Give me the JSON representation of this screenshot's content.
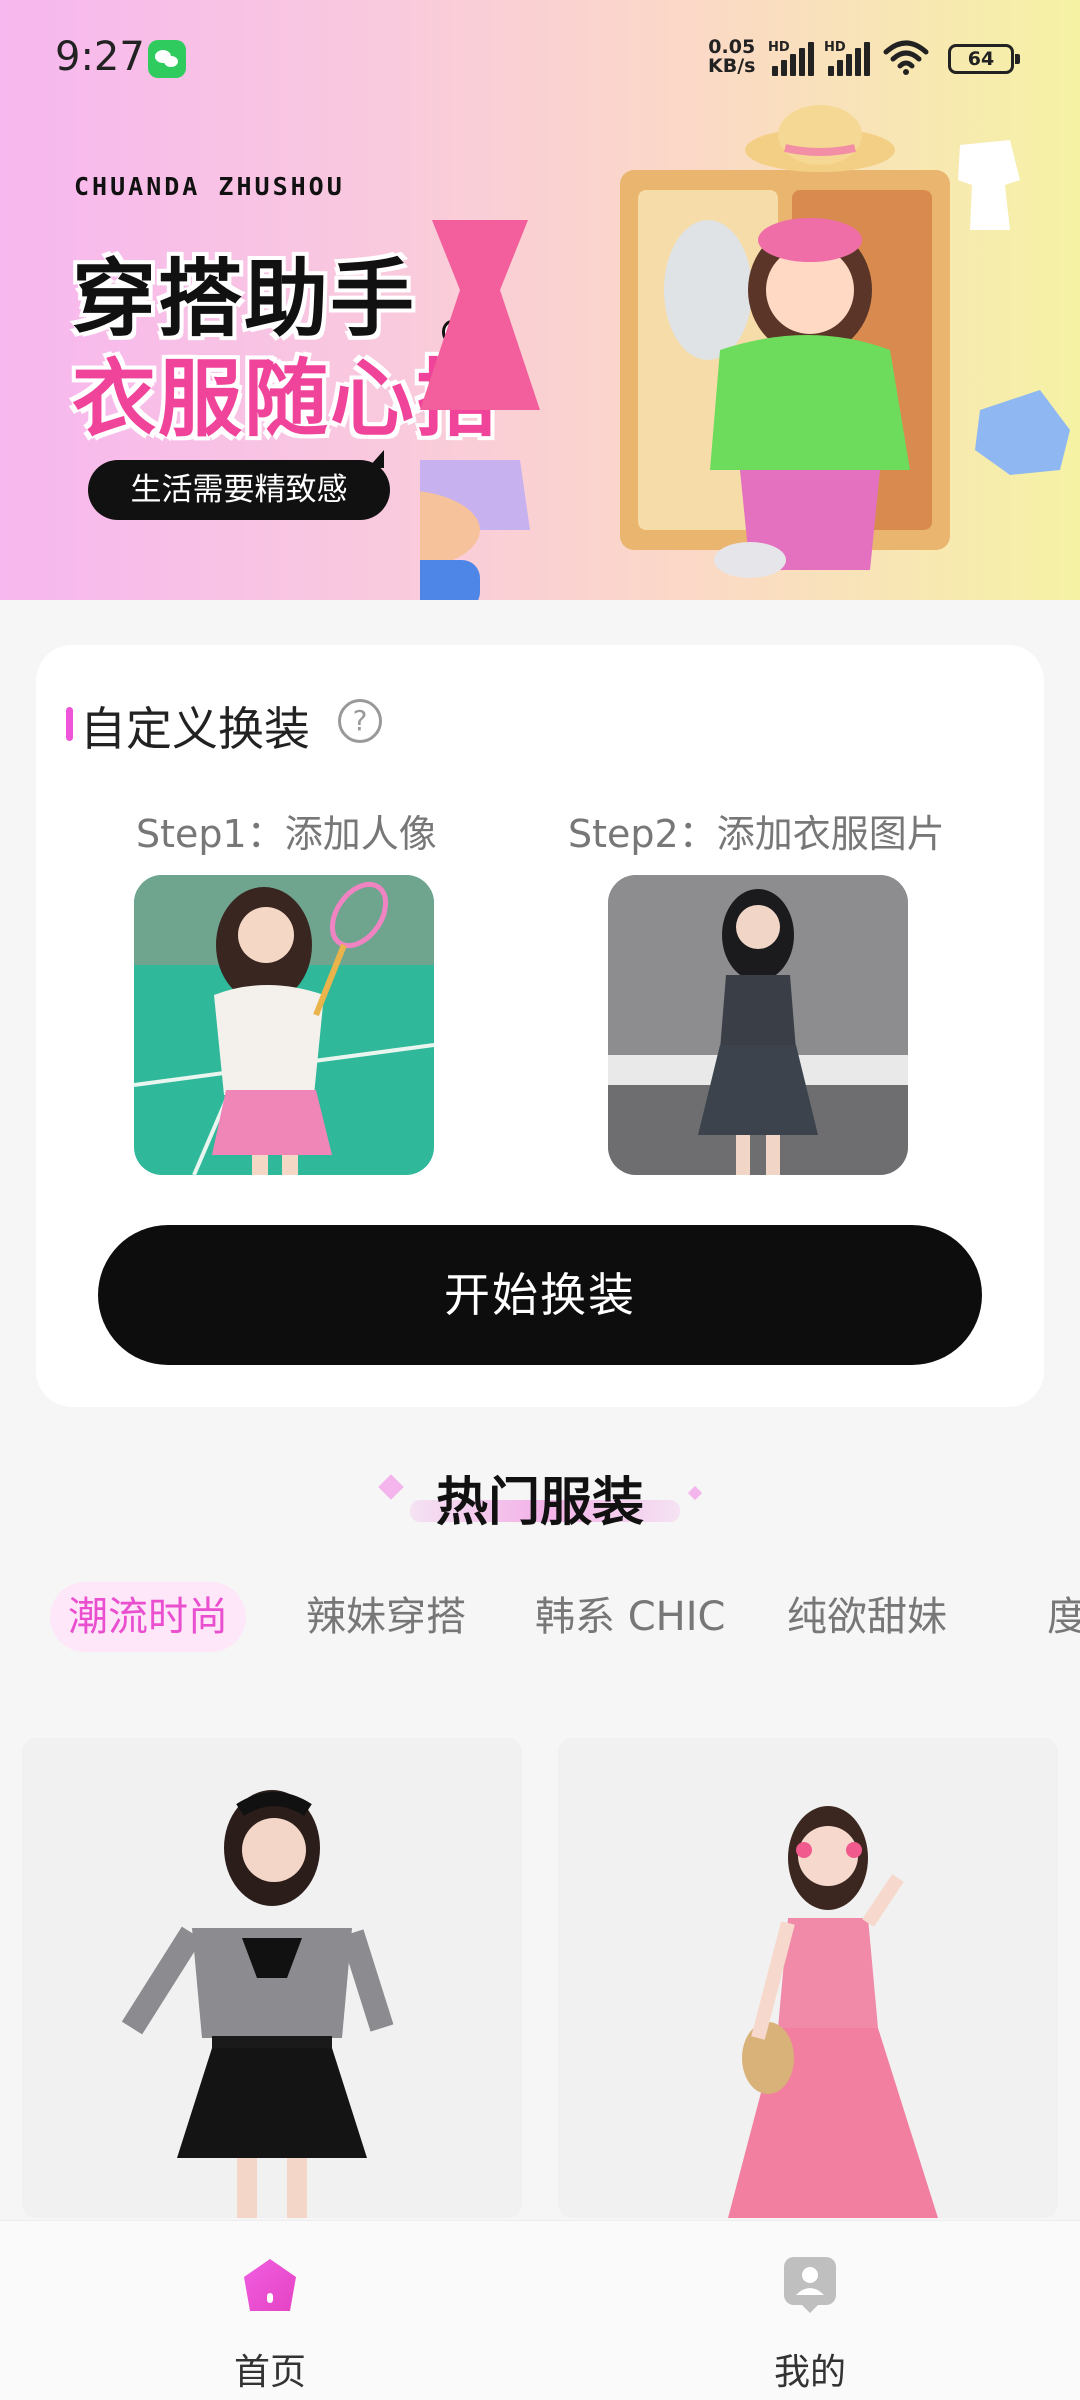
{
  "status_bar": {
    "time": "9:27",
    "net_speed_value": "0.05",
    "net_speed_unit": "KB/s",
    "signal_badge": "HD",
    "battery": "64"
  },
  "banner": {
    "brand_en": "CHUANDA ZHUSHOU",
    "title": "穿搭助手",
    "subtitle": "衣服随心搭",
    "slogan": "生活需要精致感",
    "accent_color": "#f0439a"
  },
  "custom": {
    "title": "自定义换装",
    "help": "?",
    "step1_label": "Step1：添加人像",
    "step2_label": "Step2：添加衣服图片",
    "start_button": "开始换装"
  },
  "hot": {
    "title": "热门服装",
    "tabs": [
      "潮流时尚",
      "辣妹穿搭",
      "韩系 CHIC",
      "纯欲甜妹",
      "度"
    ],
    "active_tab": 0,
    "accent_color": "#ea4fd0"
  },
  "nav": {
    "items": [
      {
        "label": "首页",
        "icon": "home-icon",
        "active": true
      },
      {
        "label": "我的",
        "icon": "profile-icon",
        "active": false
      }
    ]
  }
}
